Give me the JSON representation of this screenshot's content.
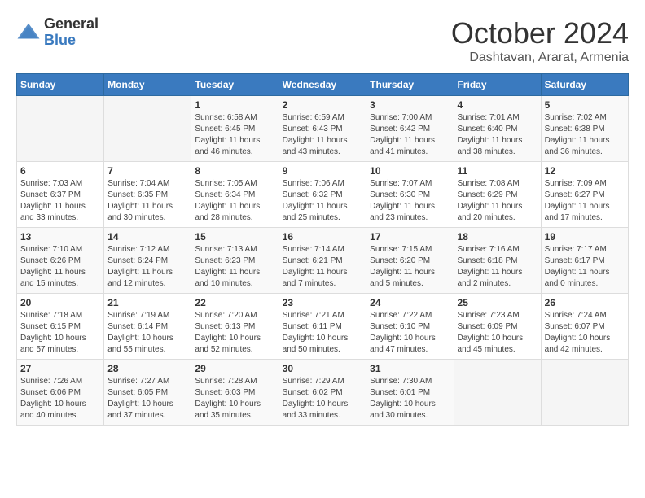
{
  "header": {
    "logo_general": "General",
    "logo_blue": "Blue",
    "month_title": "October 2024",
    "location": "Dashtavan, Ararat, Armenia"
  },
  "days_of_week": [
    "Sunday",
    "Monday",
    "Tuesday",
    "Wednesday",
    "Thursday",
    "Friday",
    "Saturday"
  ],
  "weeks": [
    [
      {
        "day": "",
        "sunrise": "",
        "sunset": "",
        "daylight": ""
      },
      {
        "day": "",
        "sunrise": "",
        "sunset": "",
        "daylight": ""
      },
      {
        "day": "1",
        "sunrise": "Sunrise: 6:58 AM",
        "sunset": "Sunset: 6:45 PM",
        "daylight": "Daylight: 11 hours and 46 minutes."
      },
      {
        "day": "2",
        "sunrise": "Sunrise: 6:59 AM",
        "sunset": "Sunset: 6:43 PM",
        "daylight": "Daylight: 11 hours and 43 minutes."
      },
      {
        "day": "3",
        "sunrise": "Sunrise: 7:00 AM",
        "sunset": "Sunset: 6:42 PM",
        "daylight": "Daylight: 11 hours and 41 minutes."
      },
      {
        "day": "4",
        "sunrise": "Sunrise: 7:01 AM",
        "sunset": "Sunset: 6:40 PM",
        "daylight": "Daylight: 11 hours and 38 minutes."
      },
      {
        "day": "5",
        "sunrise": "Sunrise: 7:02 AM",
        "sunset": "Sunset: 6:38 PM",
        "daylight": "Daylight: 11 hours and 36 minutes."
      }
    ],
    [
      {
        "day": "6",
        "sunrise": "Sunrise: 7:03 AM",
        "sunset": "Sunset: 6:37 PM",
        "daylight": "Daylight: 11 hours and 33 minutes."
      },
      {
        "day": "7",
        "sunrise": "Sunrise: 7:04 AM",
        "sunset": "Sunset: 6:35 PM",
        "daylight": "Daylight: 11 hours and 30 minutes."
      },
      {
        "day": "8",
        "sunrise": "Sunrise: 7:05 AM",
        "sunset": "Sunset: 6:34 PM",
        "daylight": "Daylight: 11 hours and 28 minutes."
      },
      {
        "day": "9",
        "sunrise": "Sunrise: 7:06 AM",
        "sunset": "Sunset: 6:32 PM",
        "daylight": "Daylight: 11 hours and 25 minutes."
      },
      {
        "day": "10",
        "sunrise": "Sunrise: 7:07 AM",
        "sunset": "Sunset: 6:30 PM",
        "daylight": "Daylight: 11 hours and 23 minutes."
      },
      {
        "day": "11",
        "sunrise": "Sunrise: 7:08 AM",
        "sunset": "Sunset: 6:29 PM",
        "daylight": "Daylight: 11 hours and 20 minutes."
      },
      {
        "day": "12",
        "sunrise": "Sunrise: 7:09 AM",
        "sunset": "Sunset: 6:27 PM",
        "daylight": "Daylight: 11 hours and 17 minutes."
      }
    ],
    [
      {
        "day": "13",
        "sunrise": "Sunrise: 7:10 AM",
        "sunset": "Sunset: 6:26 PM",
        "daylight": "Daylight: 11 hours and 15 minutes."
      },
      {
        "day": "14",
        "sunrise": "Sunrise: 7:12 AM",
        "sunset": "Sunset: 6:24 PM",
        "daylight": "Daylight: 11 hours and 12 minutes."
      },
      {
        "day": "15",
        "sunrise": "Sunrise: 7:13 AM",
        "sunset": "Sunset: 6:23 PM",
        "daylight": "Daylight: 11 hours and 10 minutes."
      },
      {
        "day": "16",
        "sunrise": "Sunrise: 7:14 AM",
        "sunset": "Sunset: 6:21 PM",
        "daylight": "Daylight: 11 hours and 7 minutes."
      },
      {
        "day": "17",
        "sunrise": "Sunrise: 7:15 AM",
        "sunset": "Sunset: 6:20 PM",
        "daylight": "Daylight: 11 hours and 5 minutes."
      },
      {
        "day": "18",
        "sunrise": "Sunrise: 7:16 AM",
        "sunset": "Sunset: 6:18 PM",
        "daylight": "Daylight: 11 hours and 2 minutes."
      },
      {
        "day": "19",
        "sunrise": "Sunrise: 7:17 AM",
        "sunset": "Sunset: 6:17 PM",
        "daylight": "Daylight: 11 hours and 0 minutes."
      }
    ],
    [
      {
        "day": "20",
        "sunrise": "Sunrise: 7:18 AM",
        "sunset": "Sunset: 6:15 PM",
        "daylight": "Daylight: 10 hours and 57 minutes."
      },
      {
        "day": "21",
        "sunrise": "Sunrise: 7:19 AM",
        "sunset": "Sunset: 6:14 PM",
        "daylight": "Daylight: 10 hours and 55 minutes."
      },
      {
        "day": "22",
        "sunrise": "Sunrise: 7:20 AM",
        "sunset": "Sunset: 6:13 PM",
        "daylight": "Daylight: 10 hours and 52 minutes."
      },
      {
        "day": "23",
        "sunrise": "Sunrise: 7:21 AM",
        "sunset": "Sunset: 6:11 PM",
        "daylight": "Daylight: 10 hours and 50 minutes."
      },
      {
        "day": "24",
        "sunrise": "Sunrise: 7:22 AM",
        "sunset": "Sunset: 6:10 PM",
        "daylight": "Daylight: 10 hours and 47 minutes."
      },
      {
        "day": "25",
        "sunrise": "Sunrise: 7:23 AM",
        "sunset": "Sunset: 6:09 PM",
        "daylight": "Daylight: 10 hours and 45 minutes."
      },
      {
        "day": "26",
        "sunrise": "Sunrise: 7:24 AM",
        "sunset": "Sunset: 6:07 PM",
        "daylight": "Daylight: 10 hours and 42 minutes."
      }
    ],
    [
      {
        "day": "27",
        "sunrise": "Sunrise: 7:26 AM",
        "sunset": "Sunset: 6:06 PM",
        "daylight": "Daylight: 10 hours and 40 minutes."
      },
      {
        "day": "28",
        "sunrise": "Sunrise: 7:27 AM",
        "sunset": "Sunset: 6:05 PM",
        "daylight": "Daylight: 10 hours and 37 minutes."
      },
      {
        "day": "29",
        "sunrise": "Sunrise: 7:28 AM",
        "sunset": "Sunset: 6:03 PM",
        "daylight": "Daylight: 10 hours and 35 minutes."
      },
      {
        "day": "30",
        "sunrise": "Sunrise: 7:29 AM",
        "sunset": "Sunset: 6:02 PM",
        "daylight": "Daylight: 10 hours and 33 minutes."
      },
      {
        "day": "31",
        "sunrise": "Sunrise: 7:30 AM",
        "sunset": "Sunset: 6:01 PM",
        "daylight": "Daylight: 10 hours and 30 minutes."
      },
      {
        "day": "",
        "sunrise": "",
        "sunset": "",
        "daylight": ""
      },
      {
        "day": "",
        "sunrise": "",
        "sunset": "",
        "daylight": ""
      }
    ]
  ]
}
